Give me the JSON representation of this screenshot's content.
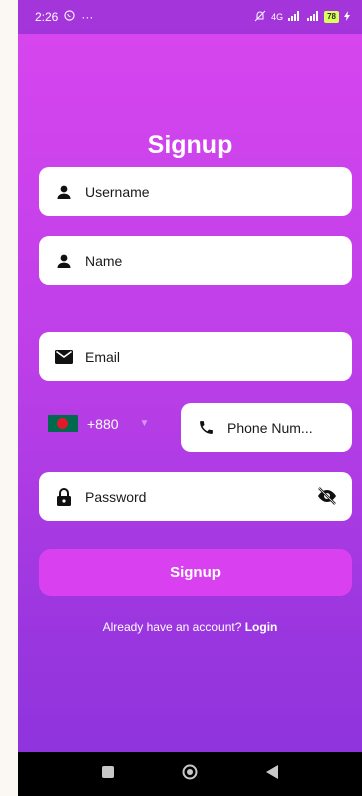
{
  "status_bar": {
    "time": "2:26",
    "dots": "···",
    "net_label": "4G",
    "battery": "78"
  },
  "page": {
    "title": "Signup"
  },
  "form": {
    "username_placeholder": "Username",
    "name_placeholder": "Name",
    "email_placeholder": "Email",
    "country_code": "+880",
    "phone_placeholder": "Phone Num...",
    "password_placeholder": "Password"
  },
  "actions": {
    "signup_label": "Signup",
    "already_text": "Already have an account?",
    "login_label": "Login"
  },
  "colors": {
    "accent": "#d940f0",
    "gradient_top": "#d946ef",
    "gradient_bottom": "#8b33dc"
  },
  "icons": [
    "whatsapp-icon",
    "person-icon",
    "mail-icon",
    "phone-icon",
    "lock-icon",
    "eye-off-icon",
    "flag-bangladesh-icon",
    "square-nav-icon",
    "circle-nav-icon",
    "back-nav-icon"
  ]
}
